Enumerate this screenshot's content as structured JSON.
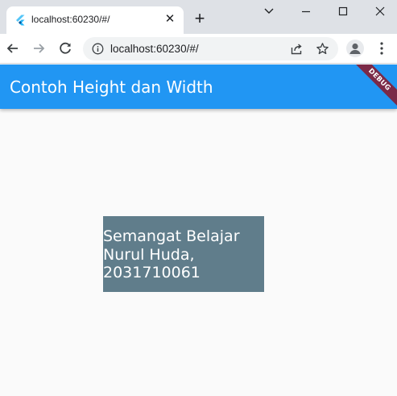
{
  "browser": {
    "tab_title": "localhost:60230/#/",
    "tab_close_glyph": "✕",
    "new_tab_glyph": "+",
    "url": "localhost:60230/#/",
    "icons": [
      "flutter-favicon",
      "close-icon",
      "plus-icon",
      "chevron-down-icon",
      "minimize-icon",
      "maximize-icon",
      "window-close-icon",
      "back-arrow-icon",
      "forward-arrow-icon",
      "reload-icon",
      "info-icon",
      "share-icon",
      "star-icon",
      "profile-icon",
      "kebab-menu-icon"
    ]
  },
  "app": {
    "title": "Contoh Height dan Width",
    "debug_banner": "DEBUG",
    "box_lines": [
      "Semangat Belajar",
      "Nurul Huda,",
      "2031710061"
    ]
  },
  "colors": {
    "appbar": "#2196f3",
    "box": "#607d8b",
    "debug_banner": "#7b2a48",
    "background": "#fafafa"
  }
}
